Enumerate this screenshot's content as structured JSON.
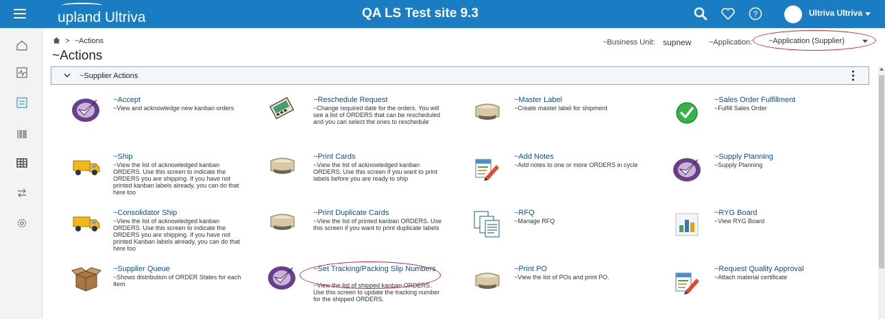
{
  "topbar": {
    "logo": "upland Ultriva",
    "site_title": "QA LS Test site 9.3",
    "user_name": "Ultriva Ultriva",
    "icons": [
      "menu-icon",
      "search-icon",
      "heart-icon",
      "help-icon",
      "user-avatar"
    ]
  },
  "sidebar": {
    "items": [
      "home-icon",
      "monitor-icon",
      "checklist-icon",
      "barcode-icon",
      "grid-icon",
      "exchange-icon",
      "settings-icon"
    ]
  },
  "breadcrumb": {
    "current": "~Actions"
  },
  "page": {
    "title": "~Actions"
  },
  "business_unit": {
    "label": "~Business Unit:",
    "value": "supnew"
  },
  "application": {
    "label": "~Application:",
    "selected": "~Application (Supplier)"
  },
  "panel": {
    "title": "~Supplier Actions"
  },
  "actions": [
    {
      "title": "~Accept",
      "desc": "~View and acknowledge new kanban orders",
      "icon": "checkmark-swoosh-icon"
    },
    {
      "title": "~Reschedule Request",
      "desc": "~Change required date for the orders. You will see a list of ORDERS that can be rescheduled and you can select the ones to reschedule",
      "icon": "reschedule-icon"
    },
    {
      "title": "~Master Label",
      "desc": "~Create master label for shipment",
      "icon": "printer-icon"
    },
    {
      "title": "~Sales Order Fulfillment",
      "desc": "~Fulfill Sales Order",
      "icon": "green-check-icon"
    },
    {
      "title": "~Ship",
      "desc": "~View the list of acknowledged kanban ORDERS. Use this screen to indicate the ORDERS you are shipping. If you have not printed kanban labels already, you can do that here too",
      "icon": "truck-icon"
    },
    {
      "title": "~Print Cards",
      "desc": "~View the list of acknowledged kanban ORDERS. Use this screen if you want to print labels before you are ready to ship",
      "icon": "printer-icon"
    },
    {
      "title": "~Add Notes",
      "desc": "~Add notes to one or more ORDERS in cycle",
      "icon": "notes-pencil-icon"
    },
    {
      "title": "~Supply Planning",
      "desc": "~Supply Planning",
      "icon": "checkmark-swoosh-icon"
    },
    {
      "title": "~Consolidator Ship",
      "desc": "~View the list of acknowledged kanban ORDERS. Use this screen to indicate the ORDERS you are shipping. If you have not printed Kanban labels already, you can do that here too",
      "icon": "truck-icon"
    },
    {
      "title": "~Print Duplicate Cards",
      "desc": "~View the list of printed kanban ORDERS. Use this screen if you want to print duplicate labels",
      "icon": "printer-icon"
    },
    {
      "title": "~RFQ",
      "desc": "~Manage RFQ",
      "icon": "documents-icon"
    },
    {
      "title": "~RYG Board",
      "desc": "~View RYG Board",
      "icon": "chart-board-icon"
    },
    {
      "title": "~Supplier Queue",
      "desc": "~Shows distribution of ORDER States for each Item",
      "icon": "box-icon"
    },
    {
      "title": "~Set Tracking/Packing Slip Numbers",
      "desc": "~View the list of shipped kanban ORDERS. Use this screen to update the tracking number for the shipped ORDERS.",
      "icon": "checkmark-swoosh-icon"
    },
    {
      "title": "~Print PO",
      "desc": "~View the list of POs and print PO.",
      "icon": "printer-icon"
    },
    {
      "title": "~Request Quality Approval",
      "desc": "~Attach material certificate",
      "icon": "notes-pencil-icon"
    }
  ],
  "colors": {
    "topbar": "#1a7dc4",
    "link": "#0e4f86",
    "highlight": "#d3212d",
    "panel_border": "#7aaed8"
  }
}
